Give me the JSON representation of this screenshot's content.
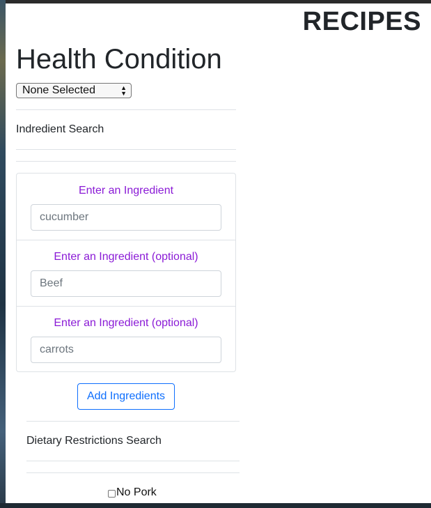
{
  "app": {
    "title": "RECIPES"
  },
  "health": {
    "heading": "Health Condition",
    "select_value": "None Selected"
  },
  "ingredient_search": {
    "label": "Indredient Search",
    "fields": [
      {
        "label": "Enter an Ingredient",
        "value": "cucumber"
      },
      {
        "label": "Enter an Ingredient (optional)",
        "value": "Beef"
      },
      {
        "label": "Enter an Ingredient (optional)",
        "value": "carrots"
      }
    ],
    "add_button_label": "Add Ingredients",
    "label_color": "#8a1ad6",
    "button_color": "#0d6efd"
  },
  "dietary": {
    "label": "Dietary Restrictions Search",
    "options": [
      {
        "label": "No Pork",
        "checked": false
      }
    ]
  }
}
